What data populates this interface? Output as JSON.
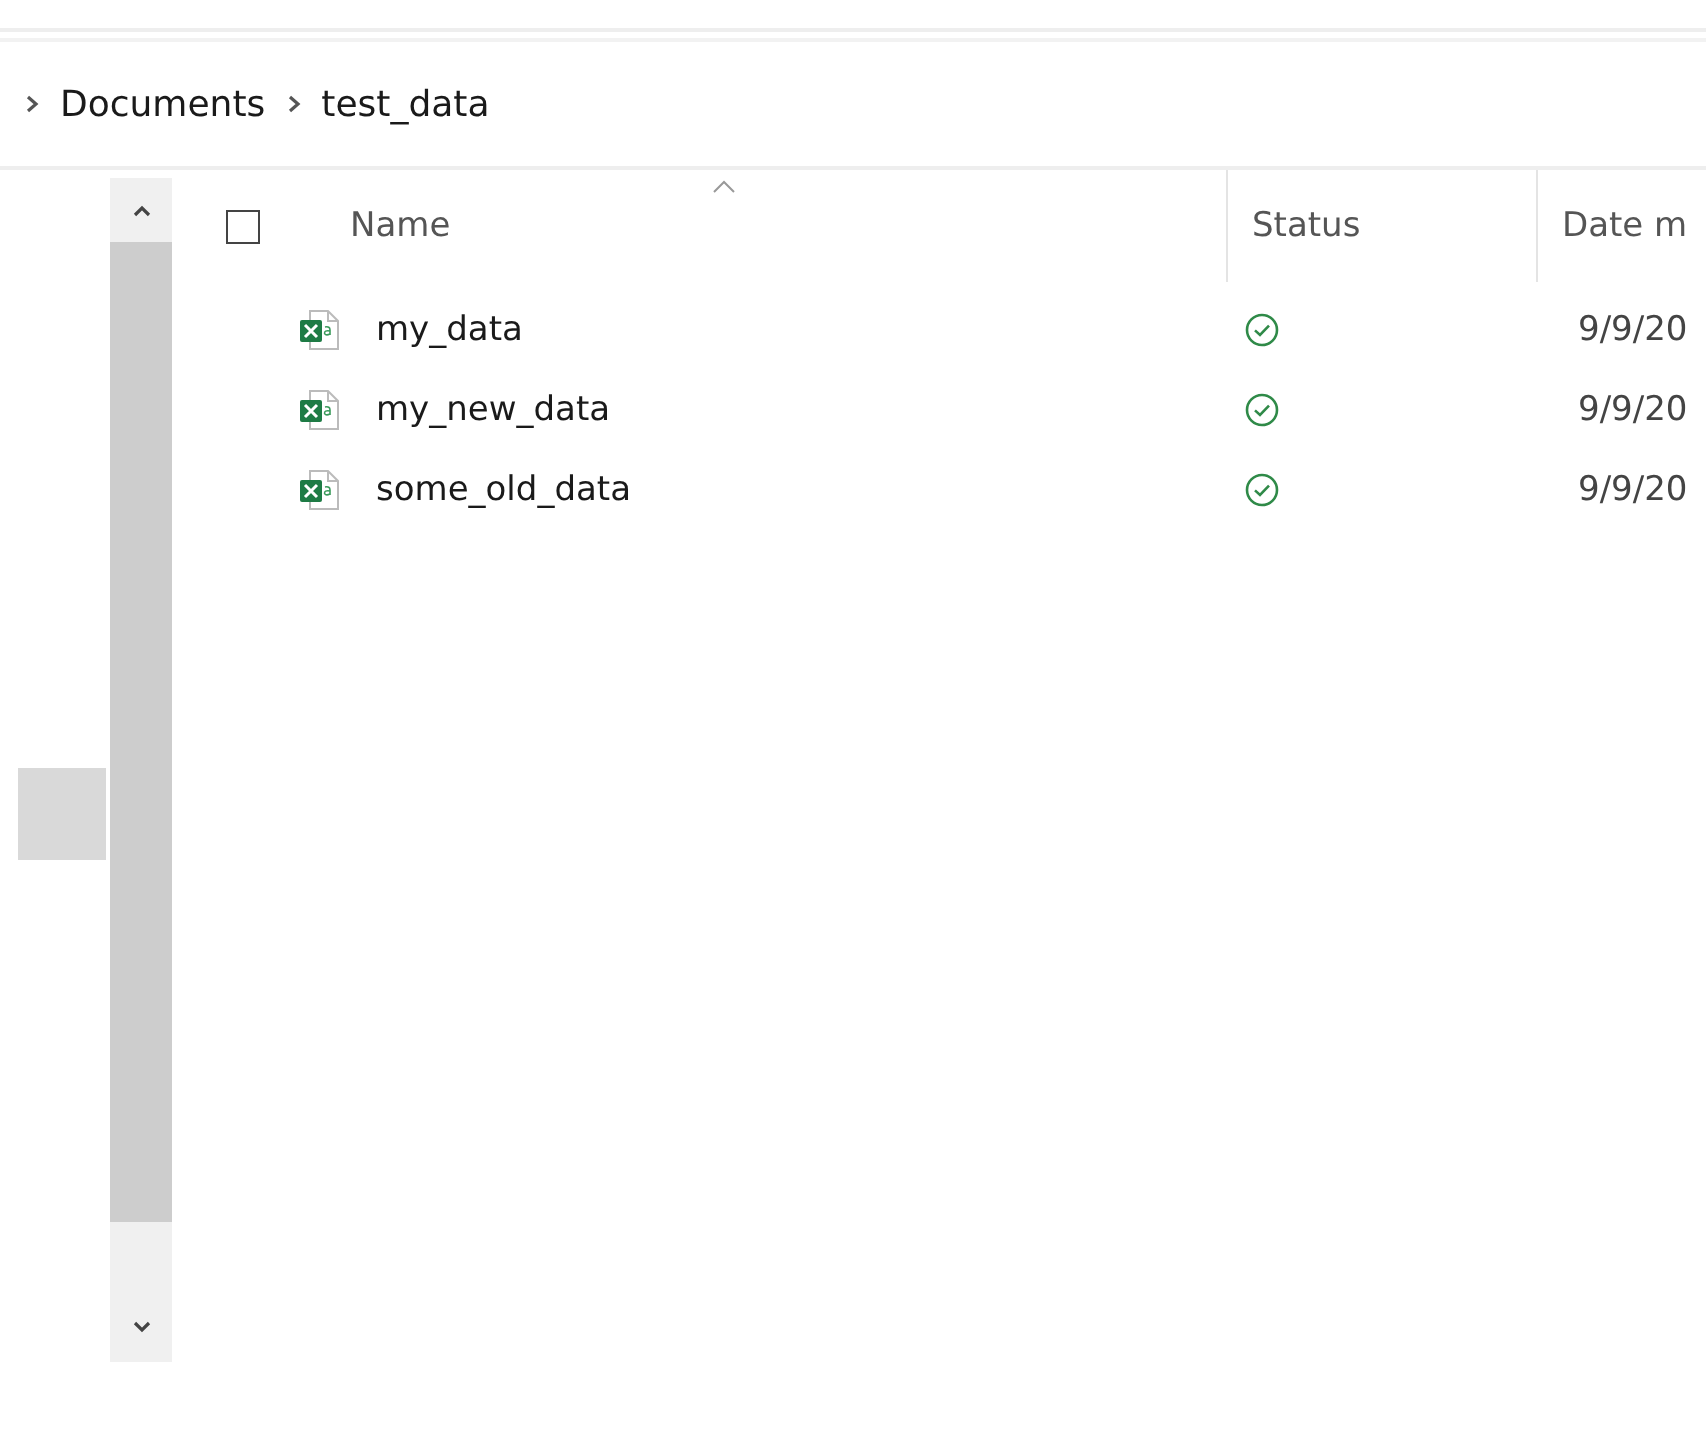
{
  "breadcrumb": [
    {
      "label": "Documents"
    },
    {
      "label": "test_data"
    }
  ],
  "file_list": {
    "select_all": {
      "checked": false
    },
    "columns": [
      {
        "label": "Name",
        "sorted": true
      },
      {
        "label": "Status",
        "sorted": false
      },
      {
        "label": "Date m",
        "sorted": false
      }
    ],
    "rows": [
      {
        "name": "my_data",
        "kind": "synced",
        "date": "9/9/20"
      },
      {
        "name": "my_new_data",
        "kind": "synced",
        "date": "9/9/20"
      },
      {
        "name": "some_old_data",
        "kind": "synced",
        "date": "9/9/20"
      }
    ]
  }
}
